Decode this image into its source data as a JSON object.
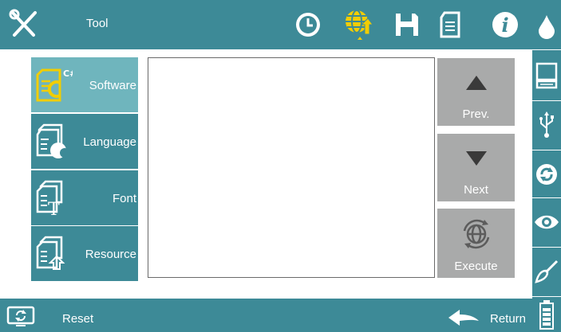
{
  "header": {
    "title": "Tool",
    "icons": [
      "tools-icon",
      "clock-icon",
      "globe-upload-icon",
      "save-icon",
      "document-icon",
      "info-icon"
    ]
  },
  "menu": {
    "items": [
      {
        "label": "Software",
        "icon": "software-file-icon",
        "active": true
      },
      {
        "label": "Language",
        "icon": "language-file-icon",
        "active": false
      },
      {
        "label": "Font",
        "icon": "font-file-icon",
        "active": false
      },
      {
        "label": "Resource",
        "icon": "resource-file-icon",
        "active": false
      }
    ]
  },
  "controls": {
    "prev_label": "Prev.",
    "next_label": "Next",
    "execute_label": "Execute"
  },
  "footer": {
    "reset_label": "Reset",
    "return_label": "Return"
  },
  "sidebar_right": {
    "icons": [
      "ink-drop-icon",
      "monitor-icon",
      "usb-icon",
      "refresh-icon",
      "eye-icon",
      "brush-icon",
      "battery-icon"
    ]
  },
  "colors": {
    "primary": "#3d8a97",
    "active_item": "#6fb5bd",
    "highlight": "#f2cd00",
    "button_gray": "#a9aaaa"
  }
}
